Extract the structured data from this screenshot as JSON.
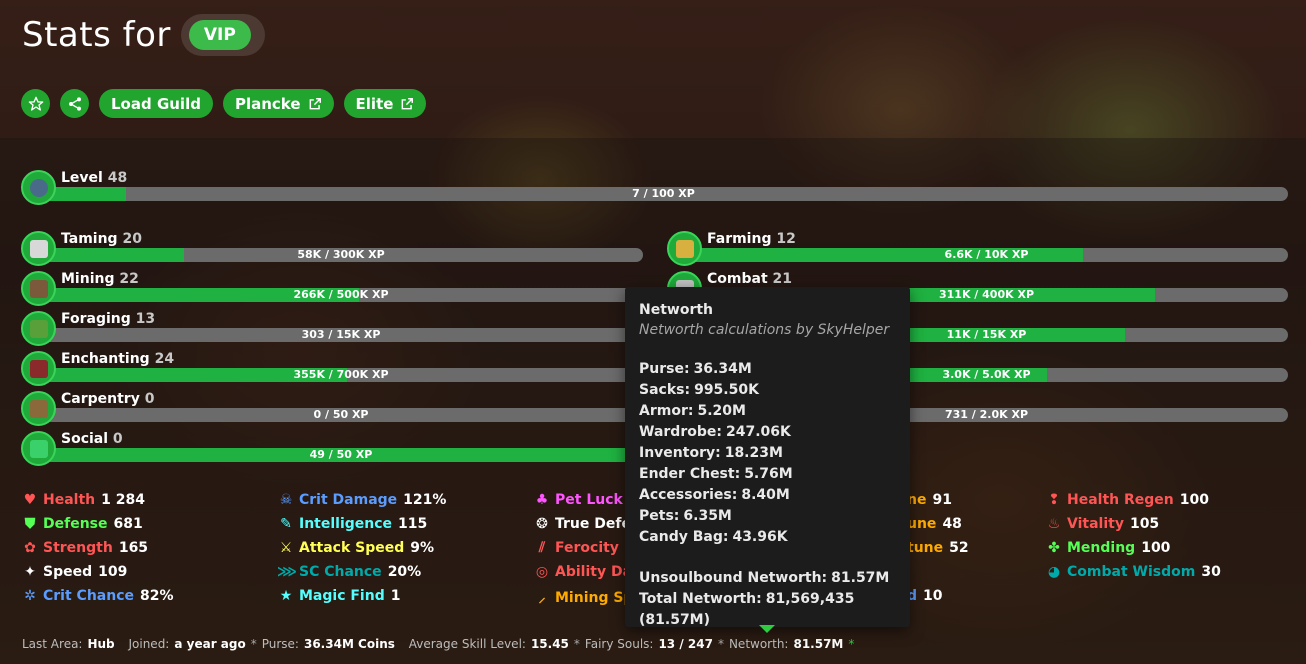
{
  "header": {
    "title": "Stats for",
    "badge": "VIP",
    "actions": {
      "load_guild": "Load Guild",
      "plancke": "Plancke",
      "elite": "Elite"
    }
  },
  "level": {
    "name": "Level",
    "level": "48",
    "xp_text": "7 / 100 XP",
    "progress": 0.07
  },
  "skills_left": [
    {
      "name": "Taming",
      "level": "20",
      "xp_text": "58K / 300K XP",
      "progress": 0.24,
      "icon": "egg-icon",
      "color": "#d8d8d8"
    },
    {
      "name": "Mining",
      "level": "22",
      "xp_text": "266K / 500K XP",
      "progress": 0.53,
      "icon": "pickaxe-icon",
      "color": "#7a5a3a"
    },
    {
      "name": "Foraging",
      "level": "13",
      "xp_text": "303 / 15K XP",
      "progress": 0.02,
      "icon": "sapling-icon",
      "color": "#5aa03a"
    },
    {
      "name": "Enchanting",
      "level": "24",
      "xp_text": "355K / 700K XP",
      "progress": 0.51,
      "icon": "enchanting-table-icon",
      "color": "#8a2a2a"
    },
    {
      "name": "Carpentry",
      "level": "0",
      "xp_text": "0 / 50 XP",
      "progress": 0.0,
      "icon": "crafting-table-icon",
      "color": "#8a6a3a"
    },
    {
      "name": "Social",
      "level": "0",
      "xp_text": "49 / 50 XP",
      "progress": 0.98,
      "icon": "emerald-icon",
      "color": "#3ad06a"
    }
  ],
  "skills_right": [
    {
      "name": "Farming",
      "level": "12",
      "xp_text": "6.6K / 10K XP",
      "progress": 0.66,
      "icon": "hoe-icon",
      "color": "#d8b040"
    },
    {
      "name": "Combat",
      "level": "21",
      "xp_text": "311K / 400K XP",
      "progress": 0.78,
      "icon": "sword-icon",
      "color": "#c0c0c0"
    },
    {
      "name": "",
      "level": "",
      "xp_text": "11K / 15K XP",
      "progress": 0.73,
      "icon": "",
      "color": ""
    },
    {
      "name": "",
      "level": "",
      "xp_text": "3.0K / 5.0K XP",
      "progress": 0.6,
      "icon": "",
      "color": ""
    },
    {
      "name": "",
      "level": "",
      "xp_text": "731 / 2.0K XP",
      "progress": 0.37,
      "icon": "",
      "color": ""
    }
  ],
  "stats": [
    [
      {
        "name": "Health",
        "value": "1 284",
        "color": "#ff5555",
        "icon": "heart-icon"
      },
      {
        "name": "Defense",
        "value": "681",
        "color": "#55ff55",
        "icon": "shield-icon"
      },
      {
        "name": "Strength",
        "value": "165",
        "color": "#ff5555",
        "icon": "strength-icon"
      },
      {
        "name": "Speed",
        "value": "109",
        "color": "#ffffff",
        "icon": "speed-icon"
      },
      {
        "name": "Crit Chance",
        "value": "82%",
        "color": "#5b9cff",
        "icon": "crit-chance-icon"
      }
    ],
    [
      {
        "name": "Crit Damage",
        "value": "121%",
        "color": "#5b9cff",
        "icon": "skull-icon"
      },
      {
        "name": "Intelligence",
        "value": "115",
        "color": "#55ffff",
        "icon": "intelligence-icon"
      },
      {
        "name": "Attack Speed",
        "value": "9%",
        "color": "#ffff55",
        "icon": "attack-speed-icon"
      },
      {
        "name": "SC Chance",
        "value": "20%",
        "color": "#00aaaa",
        "icon": "sea-creature-icon"
      },
      {
        "name": "Magic Find",
        "value": "1",
        "color": "#55ffff",
        "icon": "star-icon"
      }
    ],
    [
      {
        "name": "Pet Luck",
        "value": "",
        "color": "#ff55ff",
        "icon": "club-icon"
      },
      {
        "name": "True Defe",
        "value": "",
        "color": "#ffffff",
        "icon": "true-defense-icon"
      },
      {
        "name": "Ferocity",
        "value": "",
        "color": "#ff5555",
        "icon": "ferocity-icon"
      },
      {
        "name": "Ability Da",
        "value": "",
        "color": "#ff5555",
        "icon": "ability-damage-icon"
      },
      {
        "name": "Mining Sp",
        "value": "",
        "color": "#ffaa00",
        "icon": "mining-speed-icon"
      }
    ],
    [
      {
        "name": "ne",
        "value": "91",
        "color": "#ffaa00",
        "icon": ""
      },
      {
        "name": "une",
        "value": "48",
        "color": "#ffaa00",
        "icon": ""
      },
      {
        "name": "tune",
        "value": "52",
        "color": "#ffaa00",
        "icon": ""
      },
      {
        "name": "",
        "value": "",
        "color": "#ffaa00",
        "icon": ""
      },
      {
        "name": "d",
        "value": "10",
        "color": "#5b9cff",
        "icon": ""
      }
    ],
    [
      {
        "name": "Health Regen",
        "value": "100",
        "color": "#ff5555",
        "icon": "regen-icon"
      },
      {
        "name": "Vitality",
        "value": "105",
        "color": "#ff5555",
        "icon": "vitality-icon"
      },
      {
        "name": "Mending",
        "value": "100",
        "color": "#55ff55",
        "icon": "mending-icon"
      },
      {
        "name": "Combat Wisdom",
        "value": "30",
        "color": "#00aaaa",
        "icon": "wisdom-icon"
      }
    ]
  ],
  "footer": {
    "last_area_label": "Last Area:",
    "last_area": "Hub",
    "joined_label": "Joined:",
    "joined": "a year ago",
    "purse_label": "Purse:",
    "purse": "36.34M Coins",
    "avg_label": "Average Skill Level:",
    "avg": "15.45",
    "fairy_label": "Fairy Souls:",
    "fairy": "13 / 247",
    "networth_label": "Networth:",
    "networth": "81.57M",
    "star": "*"
  },
  "tooltip": {
    "title": "Networth",
    "subtitle": "Networth calculations by SkyHelper",
    "rows": [
      {
        "k": "Purse:",
        "v": "36.34M"
      },
      {
        "k": "Sacks:",
        "v": "995.50K"
      },
      {
        "k": "Armor:",
        "v": "5.20M"
      },
      {
        "k": "Wardrobe:",
        "v": "247.06K"
      },
      {
        "k": "Inventory:",
        "v": "18.23M"
      },
      {
        "k": "Ender Chest:",
        "v": "5.76M"
      },
      {
        "k": "Accessories:",
        "v": "8.40M"
      },
      {
        "k": "Pets:",
        "v": "6.35M"
      },
      {
        "k": "Candy Bag:",
        "v": "43.96K"
      }
    ],
    "unsoulbound_label": "Unsoulbound Networth:",
    "unsoulbound": "81.57M",
    "total_label": "Total Networth:",
    "total": "81,569,435 (81.57M)"
  }
}
